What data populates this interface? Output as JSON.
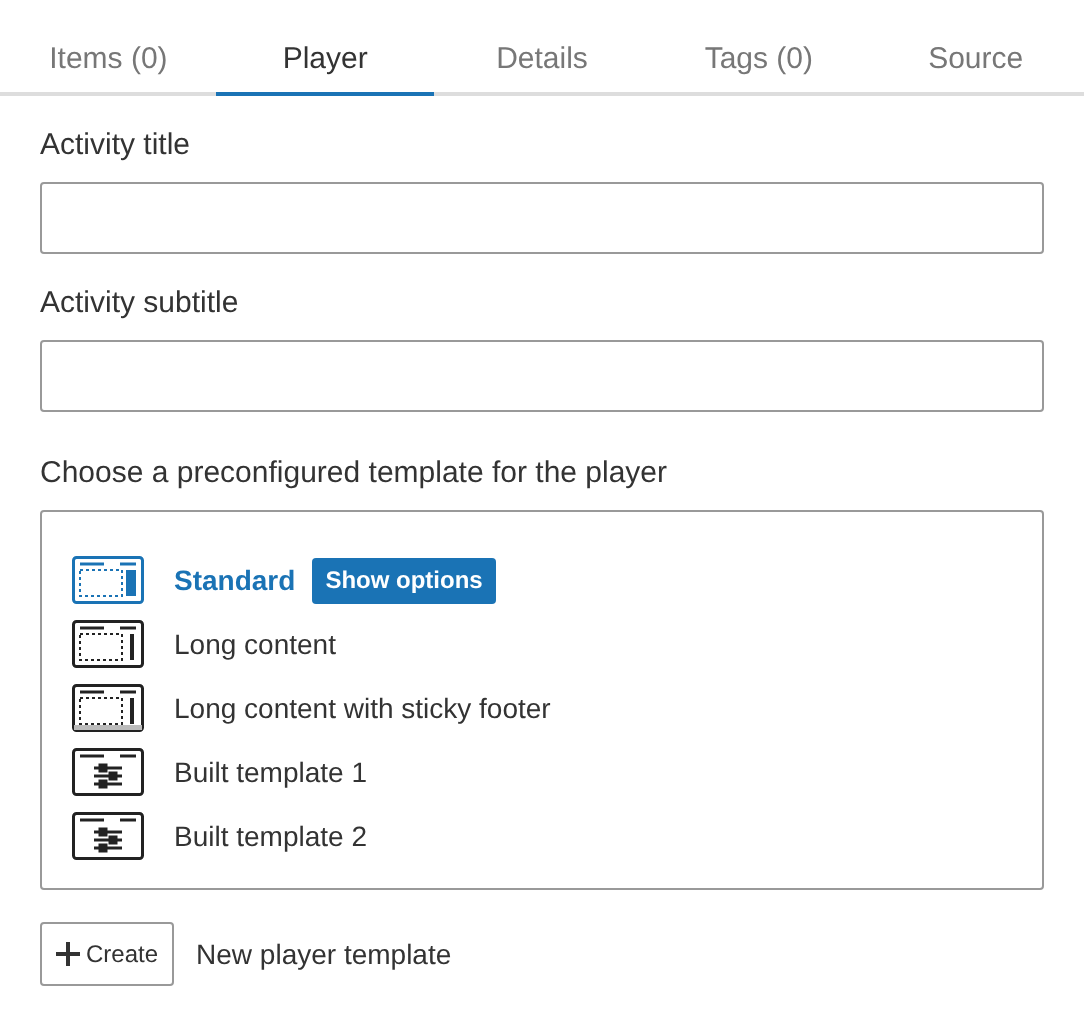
{
  "tabs": [
    {
      "label": "Items (0)",
      "selected": false
    },
    {
      "label": "Player",
      "selected": true
    },
    {
      "label": "Details",
      "selected": false
    },
    {
      "label": "Tags (0)",
      "selected": false
    },
    {
      "label": "Source",
      "selected": false
    }
  ],
  "fields": [
    {
      "label": "Activity title"
    },
    {
      "label": "Activity subtitle"
    }
  ],
  "templates": {
    "label": "Choose a preconfigured template for the player",
    "items": [
      {
        "name": "Standard",
        "kind": "layout",
        "selected": true,
        "action": "Show options"
      },
      {
        "name": "Long content",
        "kind": "layout",
        "selected": false
      },
      {
        "name": "Long content with sticky footer",
        "kind": "sticky",
        "selected": false
      },
      {
        "name": "Built template 1",
        "kind": "built",
        "selected": false
      },
      {
        "name": "Built template 2",
        "kind": "built",
        "selected": false
      }
    ]
  },
  "create": {
    "button": "Create",
    "label": "New player template"
  }
}
